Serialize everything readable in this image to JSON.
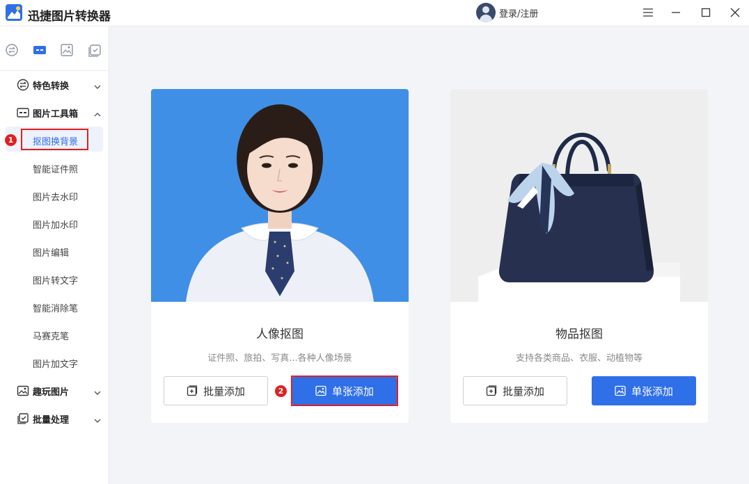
{
  "app": {
    "title": "迅捷图片转换器",
    "login_label": "登录/注册"
  },
  "window_controls": [
    "menu-icon",
    "minimize-icon",
    "maximize-icon",
    "close-icon"
  ],
  "sidebar": {
    "top_icons": [
      "swap-circle-icon",
      "toolbox-icon",
      "image-icon",
      "checklist-icon"
    ],
    "groups": [
      {
        "label": "特色转换",
        "icon": "swap-circle-icon",
        "expanded": false
      },
      {
        "label": "图片工具箱",
        "icon": "toolbox-icon",
        "expanded": true,
        "items": [
          "抠图换背景",
          "智能证件照",
          "图片去水印",
          "图片加水印",
          "图片编辑",
          "图片转文字",
          "智能消除笔",
          "马赛克笔",
          "图片加文字"
        ],
        "active_item": "抠图换背景"
      },
      {
        "label": "趣玩图片",
        "icon": "image-sparkle-icon",
        "expanded": false
      },
      {
        "label": "批量处理",
        "icon": "batch-check-icon",
        "expanded": false
      }
    ]
  },
  "cards": [
    {
      "title": "人像抠图",
      "desc": "证件照、旅拍、写真...各种人像场景",
      "batch_label": "批量添加",
      "single_label": "单张添加"
    },
    {
      "title": "物品抠图",
      "desc": "支持各类商品、衣服、动植物等",
      "batch_label": "批量添加",
      "single_label": "单张添加"
    }
  ],
  "annotations": {
    "step1": "1",
    "step2": "2"
  },
  "colors": {
    "accent": "#2f6fe8",
    "highlight": "#e02020",
    "portrait_bg": "#3f8fe6"
  }
}
